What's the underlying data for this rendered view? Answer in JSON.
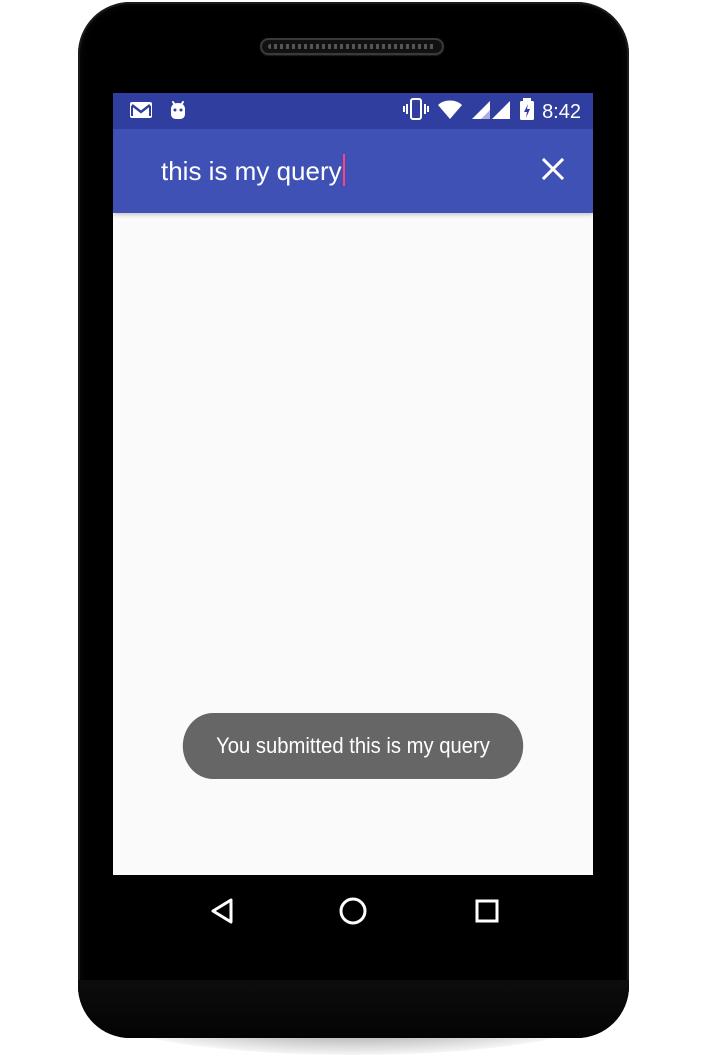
{
  "status_bar": {
    "time": "8:42",
    "left_icons": [
      "gmail-icon",
      "android-icon"
    ],
    "right_icons": [
      "vibrate-icon",
      "wifi-icon",
      "signal-icon",
      "battery-charging-icon"
    ],
    "background": "#303f9f"
  },
  "app_bar": {
    "search_query": "this is my query",
    "close_icon": "close-icon",
    "background": "#3f51b5",
    "caret_color": "#ff4081"
  },
  "toast": {
    "message": "You submitted this is my query",
    "background": "#666666"
  },
  "navigation": {
    "back_icon": "back-icon",
    "home_icon": "home-icon",
    "recents_icon": "recents-icon"
  },
  "content": {
    "background": "#fafafa"
  }
}
